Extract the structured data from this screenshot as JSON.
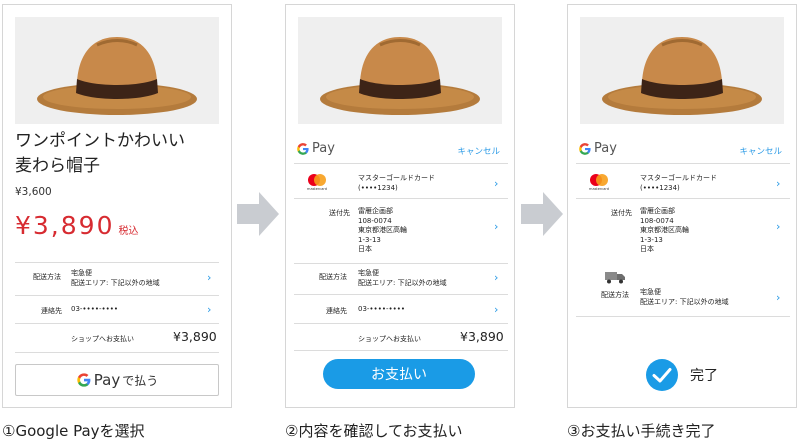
{
  "colors": {
    "accent": "#2a9ae6",
    "price_red": "#d72b31",
    "button_blue": "#1a9be6",
    "check_blue": "#1a9be6"
  },
  "screen1": {
    "title_line1": "ワンポイントかわいい",
    "title_line2": "麦わら帽子",
    "price_old": "¥3,600",
    "price_new": "¥3,890",
    "tax_label": "税込",
    "shipping_label": "配送方法",
    "shipping_value1": "宅急便",
    "shipping_value2": "配送エリア: 下記以外の地域",
    "contact_label": "連絡先",
    "contact_value": "03-••••-••••",
    "payment_label": "ショップへお支払い",
    "payment_amount": "¥3,890",
    "gpay_pay": "Pay",
    "gpay_suffix": "で払う"
  },
  "screen2": {
    "gpay_pay": "Pay",
    "cancel": "キャンセル",
    "card_name": "マスターゴールドカード",
    "card_number": "(••••1234)",
    "card_logo_text": "mastercard",
    "address_label": "送付先",
    "address_lines": [
      "雷雁企画部",
      "108-0074",
      "東京都港区高輪",
      "1-3-13",
      "日本"
    ],
    "shipping_label": "配送方法",
    "shipping_value1": "宅急便",
    "shipping_value2": "配送エリア: 下記以外の地域",
    "contact_label": "連絡先",
    "contact_value": "03-••••-••••",
    "payment_label": "ショップへお支払い",
    "payment_amount": "¥3,890",
    "pay_button": "お支払い"
  },
  "screen3": {
    "gpay_pay": "Pay",
    "cancel": "キャンセル",
    "card_name": "マスターゴールドカード",
    "card_number": "(••••1234)",
    "card_logo_text": "mastercard",
    "address_label": "送付先",
    "address_lines": [
      "雷雁企画部",
      "108-0074",
      "東京都港区高輪",
      "1-3-13",
      "日本"
    ],
    "shipping_label": "配送方法",
    "shipping_value1": "宅急便",
    "shipping_value2": "配送エリア: 下記以外の地域",
    "done_label": "完了"
  },
  "captions": {
    "step1": "①Google Payを選択",
    "step2": "②内容を確認してお支払い",
    "step3": "③お支払い手続き完了"
  }
}
